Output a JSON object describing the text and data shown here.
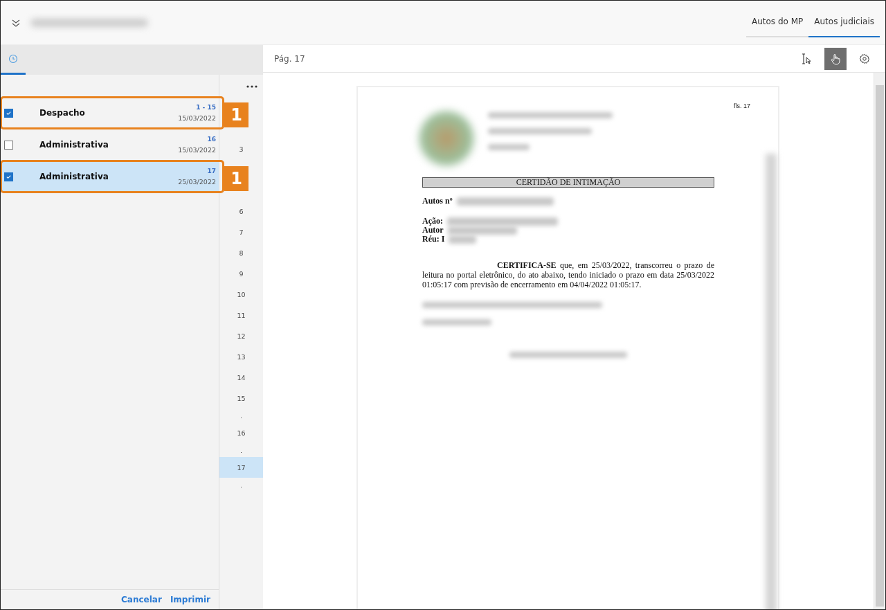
{
  "header": {
    "tabs": [
      {
        "label": "Autos do MP",
        "selected": false
      },
      {
        "label": "Autos judiciais",
        "selected": true
      }
    ]
  },
  "side_tabs": [
    {
      "selected": true
    }
  ],
  "documents": [
    {
      "title": "Despacho",
      "pages": "1 - 15",
      "date": "15/03/2022",
      "checked": true,
      "selected": false,
      "callout": "1"
    },
    {
      "title": "Administrativa",
      "pages": "16",
      "date": "15/03/2022",
      "checked": false,
      "selected": false
    },
    {
      "title": "Administrativa",
      "pages": "17",
      "date": "25/03/2022",
      "checked": true,
      "selected": true,
      "callout": "1"
    }
  ],
  "page_index": [
    {
      "kind": "gap"
    },
    {
      "kind": "gap"
    },
    {
      "kind": "page",
      "label": "3",
      "selected": false
    },
    {
      "kind": "gap"
    },
    {
      "kind": "gap"
    },
    {
      "kind": "page",
      "label": "6",
      "selected": false
    },
    {
      "kind": "page",
      "label": "7",
      "selected": false
    },
    {
      "kind": "page",
      "label": "8",
      "selected": false
    },
    {
      "kind": "page",
      "label": "9",
      "selected": false
    },
    {
      "kind": "page",
      "label": "10",
      "selected": false
    },
    {
      "kind": "page",
      "label": "11",
      "selected": false
    },
    {
      "kind": "page",
      "label": "12",
      "selected": false
    },
    {
      "kind": "page",
      "label": "13",
      "selected": false
    },
    {
      "kind": "page",
      "label": "14",
      "selected": false
    },
    {
      "kind": "page",
      "label": "15",
      "selected": false
    },
    {
      "kind": "separator",
      "label": "."
    },
    {
      "kind": "page",
      "label": "16",
      "selected": false
    },
    {
      "kind": "separator",
      "label": "."
    },
    {
      "kind": "page",
      "label": "17",
      "selected": true
    },
    {
      "kind": "separator",
      "label": "."
    }
  ],
  "footer_actions": [
    "Cancelar",
    "Imprimir"
  ],
  "viewer": {
    "page_label": "Pág. 17",
    "tools": [
      {
        "kind": "text-select",
        "selected": false
      },
      {
        "kind": "hand",
        "selected": true
      },
      {
        "kind": "settings",
        "selected": false
      }
    ]
  },
  "document": {
    "folio": "fls. 17",
    "heading": "CERTIDÃO DE INTIMAÇÃO",
    "case_label": "Autos nº",
    "fields": [
      "Ação:",
      "Autor",
      "Réu: I"
    ],
    "body": "**CERTIFICA-SE** que, em 25/03/2022, transcorreu o prazo de leitura no portal eletrônico, do ato abaixo, tendo iniciado o prazo em data 25/03/2022 01:05:17 com previsão de encerramento em 04/04/2022 01:05:17."
  }
}
